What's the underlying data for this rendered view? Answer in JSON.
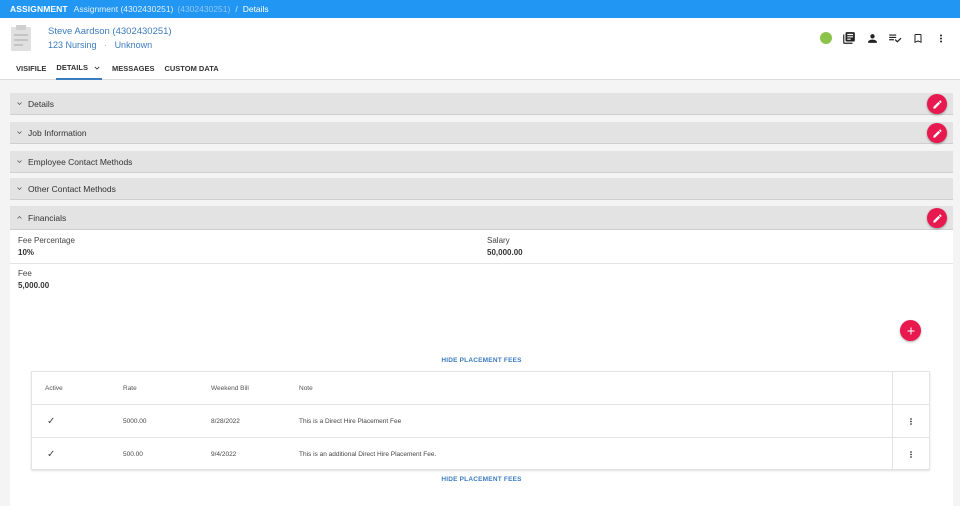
{
  "topbar": {
    "entity": "ASSIGNMENT",
    "crumb": "Assignment (4302430251)",
    "crumb_id": "(4302430251)",
    "separator": "/",
    "current": "Details"
  },
  "header": {
    "name": "Steve Aardson (4302430251)",
    "sub_a": "123 Nursing",
    "sub_dot": "·",
    "sub_b": "Unknown",
    "status_color": "#8bc34a"
  },
  "tabs": [
    {
      "label": "VISIFILE"
    },
    {
      "label": "DETAILS"
    },
    {
      "label": "MESSAGES"
    },
    {
      "label": "CUSTOM DATA"
    }
  ],
  "sections": {
    "details": "Details",
    "job": "Job Information",
    "employee_contact": "Employee Contact Methods",
    "other_contact": "Other Contact Methods",
    "financials": "Financials"
  },
  "financials": {
    "fee_percentage_label": "Fee Percentage",
    "fee_percentage_value": "10%",
    "salary_label": "Salary",
    "salary_value": "50,000.00",
    "fee_label": "Fee",
    "fee_value": "5,000.00",
    "hide_link": "HIDE PLACEMENT FEES"
  },
  "placement_fees": {
    "columns": [
      "Active",
      "Rate",
      "Weekend Bill",
      "Note"
    ],
    "rows": [
      {
        "active": "✓",
        "rate": "5000.00",
        "weekend_bill": "8/28/2022",
        "note": "This is a Direct Hire Placement Fee"
      },
      {
        "active": "✓",
        "rate": "500.00",
        "weekend_bill": "9/4/2022",
        "note": "This is an additional Direct Hire Placement Fee."
      }
    ]
  },
  "colors": {
    "accent": "#2196f3",
    "link": "#3b7bbf",
    "fab": "#e8194f"
  }
}
